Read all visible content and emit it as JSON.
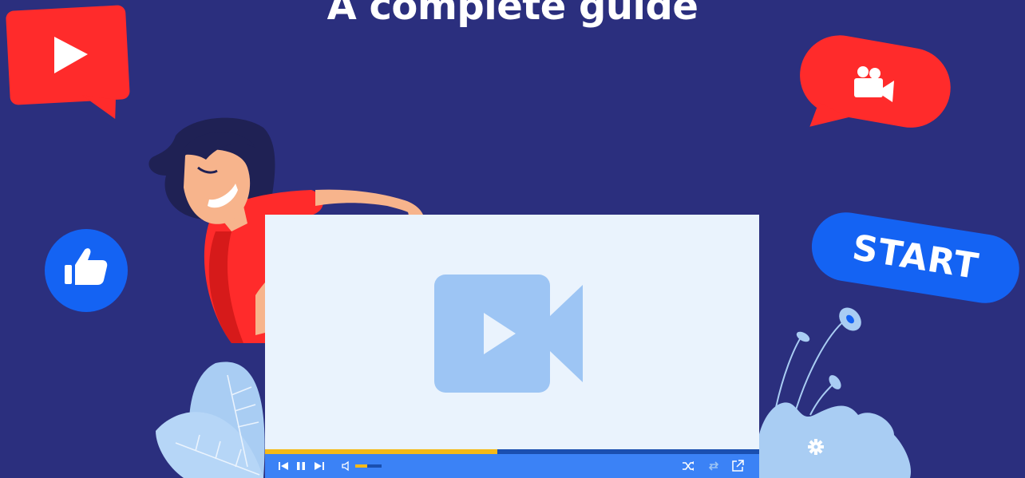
{
  "page": {
    "title": "A complete guide",
    "start_button_label": "START"
  },
  "player": {
    "progress_fraction": 0.47,
    "volume_fraction": 0.45,
    "controls": [
      "skip-back",
      "pause",
      "skip-forward",
      "volume",
      "shuffle",
      "repeat",
      "external-link"
    ]
  },
  "colors": {
    "background": "#2b2f7e",
    "accent_red": "#ff2b2b",
    "accent_blue": "#1463f3",
    "progress": "#f5b918",
    "player_bar": "#3b82f6",
    "screen": "#eaf3fd",
    "icon_light": "#9dc5f4"
  },
  "icons": [
    "play-icon",
    "video-camera-icon",
    "thumbs-up-icon",
    "video-play-icon",
    "settings-icon"
  ]
}
